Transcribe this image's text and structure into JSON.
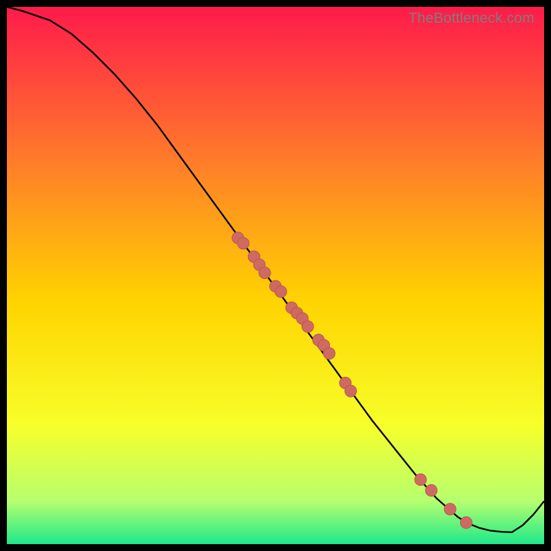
{
  "watermark": "TheBottleneck.com",
  "colors": {
    "grad_top": "#ff1a4b",
    "grad_upper_mid": "#ff7a2a",
    "grad_mid": "#ffd400",
    "grad_lower_mid": "#f7ff2a",
    "grad_near_bottom": "#b6ff6e",
    "grad_bottom": "#1ee88a",
    "curve": "#000000",
    "marker_fill": "#cf6a62",
    "marker_stroke": "#b85750"
  },
  "chart_data": {
    "type": "line",
    "title": "",
    "xlabel": "",
    "ylabel": "",
    "xlim": [
      0,
      100
    ],
    "ylim": [
      0,
      100
    ],
    "curve": {
      "x": [
        0,
        3,
        8,
        12,
        16,
        20,
        24,
        28,
        32,
        36,
        40,
        44,
        48,
        52,
        56,
        60,
        64,
        68,
        72,
        76,
        80,
        84,
        86,
        88,
        90,
        92,
        94,
        96,
        98,
        100
      ],
      "y": [
        100,
        99.2,
        97.5,
        95,
        91.5,
        87.5,
        83,
        78,
        72.5,
        67,
        61.5,
        56,
        50.5,
        45,
        39.5,
        34,
        28.5,
        23,
        18,
        13,
        8.5,
        5,
        3.8,
        3,
        2.5,
        2.3,
        2.2,
        3.5,
        5.5,
        8
      ]
    },
    "markers": {
      "x": [
        43,
        44,
        46,
        47,
        48,
        50,
        51,
        53,
        54,
        55,
        56,
        58,
        59,
        60,
        63,
        64,
        77,
        79,
        82.5,
        85.5
      ],
      "y": [
        57,
        56,
        53.5,
        52,
        50.5,
        48,
        47,
        44,
        43,
        42,
        40.5,
        38,
        37,
        35.5,
        30,
        28.5,
        12,
        10,
        6.5,
        4
      ]
    }
  }
}
